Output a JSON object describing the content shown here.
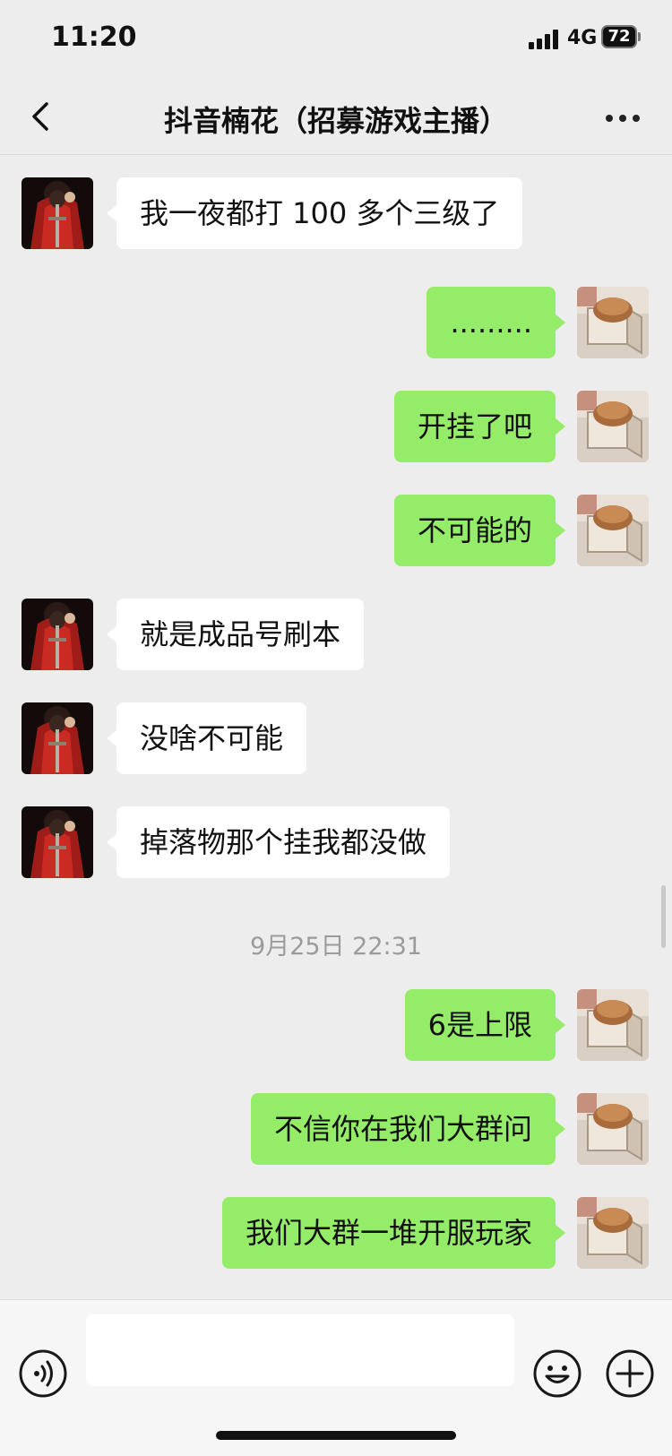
{
  "status_bar": {
    "time": "11:20",
    "network": "4G",
    "battery": "72"
  },
  "header": {
    "title": "抖音楠花（招募游戏主播）"
  },
  "messages": [
    {
      "side": "in",
      "text": "我一夜都打 100 多个三级了"
    },
    {
      "side": "out",
      "text": "........."
    },
    {
      "side": "out",
      "text": "开挂了吧"
    },
    {
      "side": "out",
      "text": "不可能的"
    },
    {
      "side": "in",
      "text": "就是成品号刷本"
    },
    {
      "side": "in",
      "text": "没啥不可能"
    },
    {
      "side": "in",
      "text": "掉落物那个挂我都没做"
    },
    {
      "side": "out",
      "text": "6是上限"
    },
    {
      "side": "out",
      "text": "不信你在我们大群问"
    },
    {
      "side": "out",
      "text": "我们大群一堆开服玩家"
    }
  ],
  "timestamp": "9月25日 22:31",
  "icons": {
    "back": "chevron-left-icon",
    "more": "more-dots-icon",
    "voice": "voice-icon",
    "emoji": "emoji-icon",
    "plus": "plus-icon"
  },
  "colors": {
    "incoming_bubble": "#ffffff",
    "outgoing_bubble": "#95ec69",
    "background": "#ededed"
  }
}
